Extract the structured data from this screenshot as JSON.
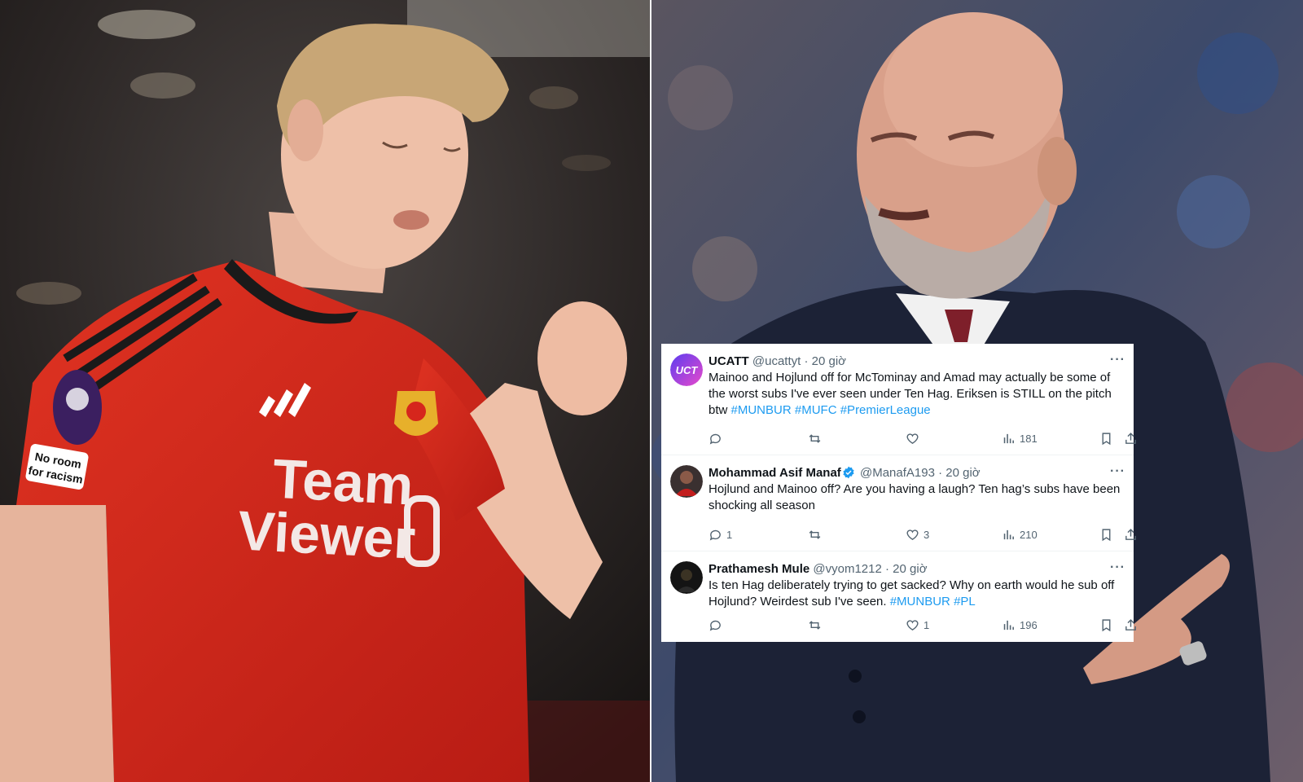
{
  "colors": {
    "tweet_background": "#ffffff",
    "text": "#0f1419",
    "secondary_text": "#536471",
    "hashtag": "#1d9bf0",
    "verified": "#1d9bf0",
    "jersey_red": "#d6261c",
    "photo_divider": "#f2f2f2"
  },
  "photos": {
    "left": {
      "subject": "player-in-red-jersey",
      "jersey_sponsor_line1": "Team",
      "jersey_sponsor_line2": "Viewer",
      "sleeve_patch_line1": "No room",
      "sleeve_patch_line2": "for racism"
    },
    "right": {
      "subject": "manager-in-dark-suit"
    }
  },
  "tweets": [
    {
      "avatar_icon": "ucatt-logo-icon",
      "avatar_text": "UCT",
      "name": "UCATT",
      "verified": false,
      "handle": "@ucattyt",
      "separator": "·",
      "time": "20 giờ",
      "text": "Mainoo and Hojlund off for McTominay and Amad may actually be some of the worst subs I've ever seen under Ten Hag. Eriksen is STILL on the pitch btw",
      "hashtags": [
        "#MUNBUR",
        "#MUFC",
        "#PremierLeague"
      ],
      "reply_count": "",
      "retweet_count": "",
      "like_count": "",
      "view_count": "181"
    },
    {
      "avatar_icon": "user-photo-icon",
      "name": "Mohammad Asif Manaf",
      "verified": true,
      "handle": "@ManafA193",
      "separator": "·",
      "time": "20 giờ",
      "text": "Hojlund and Mainoo off? Are you having a laugh? Ten hag’s subs have been shocking all season",
      "hashtags": [],
      "reply_count": "1",
      "retweet_count": "",
      "like_count": "3",
      "view_count": "210"
    },
    {
      "avatar_icon": "user-photo-icon",
      "name": "Prathamesh Mule",
      "verified": false,
      "handle": "@vyom1212",
      "separator": "·",
      "time": "20 giờ",
      "text": "Is ten Hag deliberately trying to get sacked? Why on earth would he sub off Hojlund? Weirdest sub I've seen.",
      "hashtags": [
        "#MUNBUR",
        "#PL"
      ],
      "reply_count": "",
      "retweet_count": "",
      "like_count": "1",
      "view_count": "196"
    }
  ],
  "icons": {
    "more": "more-dots-icon",
    "reply": "reply-bubble-icon",
    "retweet": "retweet-arrows-icon",
    "like": "heart-icon",
    "views": "views-bars-icon",
    "bookmark": "bookmark-icon",
    "share": "share-upload-icon",
    "verified": "verified-badge-icon",
    "more_glyph": "···"
  }
}
